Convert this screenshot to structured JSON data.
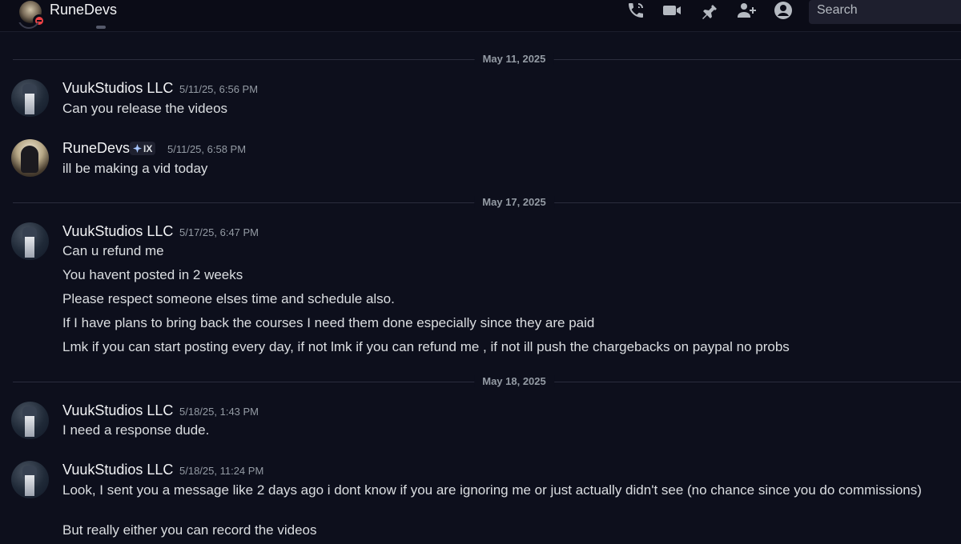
{
  "header": {
    "title": "RuneDevs",
    "search_placeholder": "Search",
    "icons": [
      "voice-call-icon",
      "video-call-icon",
      "pin-icon",
      "add-friends-icon",
      "user-profile-icon"
    ]
  },
  "dividers": [
    {
      "label": "May 11, 2025"
    },
    {
      "label": "May 17, 2025"
    },
    {
      "label": "May 18, 2025"
    }
  ],
  "messages": [
    {
      "author": "VuukStudios LLC",
      "timestamp": "5/11/25, 6:56 PM",
      "lines": [
        "Can you release the videos"
      ]
    },
    {
      "author": "RuneDevs",
      "tag": "IX",
      "timestamp": "5/11/25, 6:58 PM",
      "lines": [
        "ill be making a vid today"
      ]
    },
    {
      "author": "VuukStudios LLC",
      "timestamp": "5/17/25, 6:47 PM",
      "lines": [
        "Can u refund me",
        "You havent posted in 2 weeks",
        "Please respect someone elses time and schedule also.",
        "If I have plans to bring back the courses I need them done especially since they are paid",
        "Lmk if you can start posting every day, if not lmk if you can refund me , if not ill push the chargebacks on paypal no probs"
      ]
    },
    {
      "author": "VuukStudios LLC",
      "timestamp": "5/18/25, 1:43 PM",
      "lines": [
        "I need a response dude."
      ]
    },
    {
      "author": "VuukStudios LLC",
      "timestamp": "5/18/25, 11:24 PM",
      "lines": [
        "Look, I sent you a message like 2 days ago i dont know if you are ignoring me or just actually didn't see (no chance since you do commissions)",
        "",
        "But really either you can record the videos"
      ]
    }
  ],
  "colors": {
    "background": "#0d0f1c",
    "dnd_status": "#ed4245"
  }
}
